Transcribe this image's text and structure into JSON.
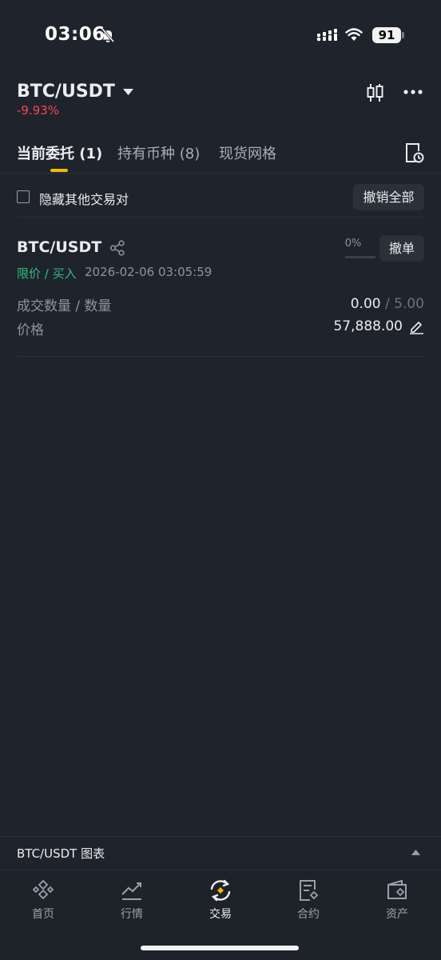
{
  "status": {
    "time": "03:06",
    "battery": "91"
  },
  "header": {
    "pair": "BTC/USDT",
    "change": "-9.93%"
  },
  "tabs": [
    {
      "label": "当前委托 (1)"
    },
    {
      "label": "持有币种 (8)"
    },
    {
      "label": "现货网格"
    }
  ],
  "filter": {
    "hide_other_pairs": "隐藏其他交易对",
    "cancel_all": "撤销全部"
  },
  "order": {
    "pair": "BTC/USDT",
    "type": "限价 / 买入",
    "time": "2026-02-06 03:05:59",
    "filled_pct_label": "0%",
    "filled_fraction": 0,
    "cancel": "撤单",
    "qty_label": "成交数量 / 数量",
    "filled": "0.00",
    "qty_sep": " / ",
    "amount": "5.00",
    "price_label": "价格",
    "price": "57,888.00"
  },
  "chart_bar": {
    "label": "BTC/USDT 图表"
  },
  "nav": [
    {
      "label": "首页"
    },
    {
      "label": "行情"
    },
    {
      "label": "交易"
    },
    {
      "label": "合约"
    },
    {
      "label": "资产"
    }
  ],
  "colors": {
    "accent": "#f0b90b",
    "buy": "#2ebd85",
    "sell": "#f6465d",
    "bg": "#1f232b"
  }
}
